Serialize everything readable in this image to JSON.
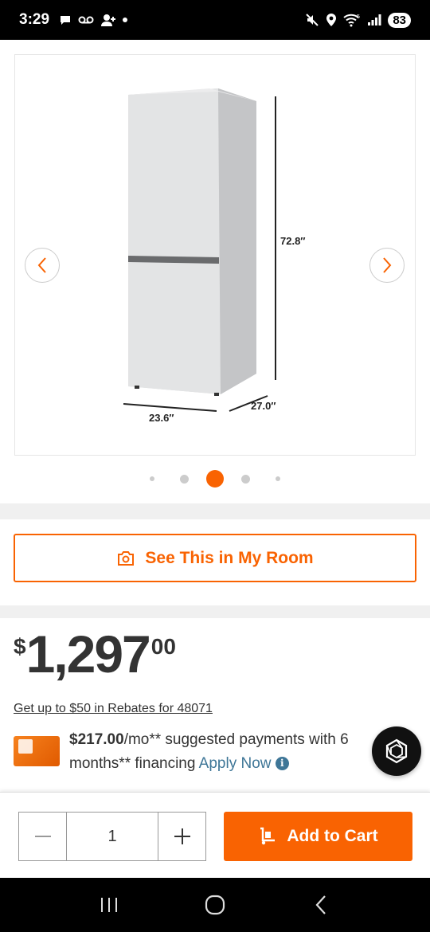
{
  "status_bar": {
    "time": "3:29",
    "battery": "83",
    "signal_label": "5"
  },
  "gallery": {
    "dimensions": {
      "height": "72.8″",
      "width": "23.6″",
      "depth": "27.0″"
    },
    "dot_count": 5,
    "active_dot": 2
  },
  "room_button": {
    "label": "See This in My Room"
  },
  "price": {
    "currency": "$",
    "dollars": "1,297",
    "cents": "00"
  },
  "rebates_link": "Get up to $50 in Rebates for 48071",
  "financing": {
    "monthly": "$217.00",
    "text_after_monthly": "/mo** suggested payments with 6 months** financing",
    "apply_label": "Apply Now",
    "info_glyph": "i"
  },
  "cart": {
    "quantity": "1",
    "add_label": "Add to Cart"
  },
  "colors": {
    "brand_orange": "#f96302",
    "link_blue": "#3e7697"
  }
}
